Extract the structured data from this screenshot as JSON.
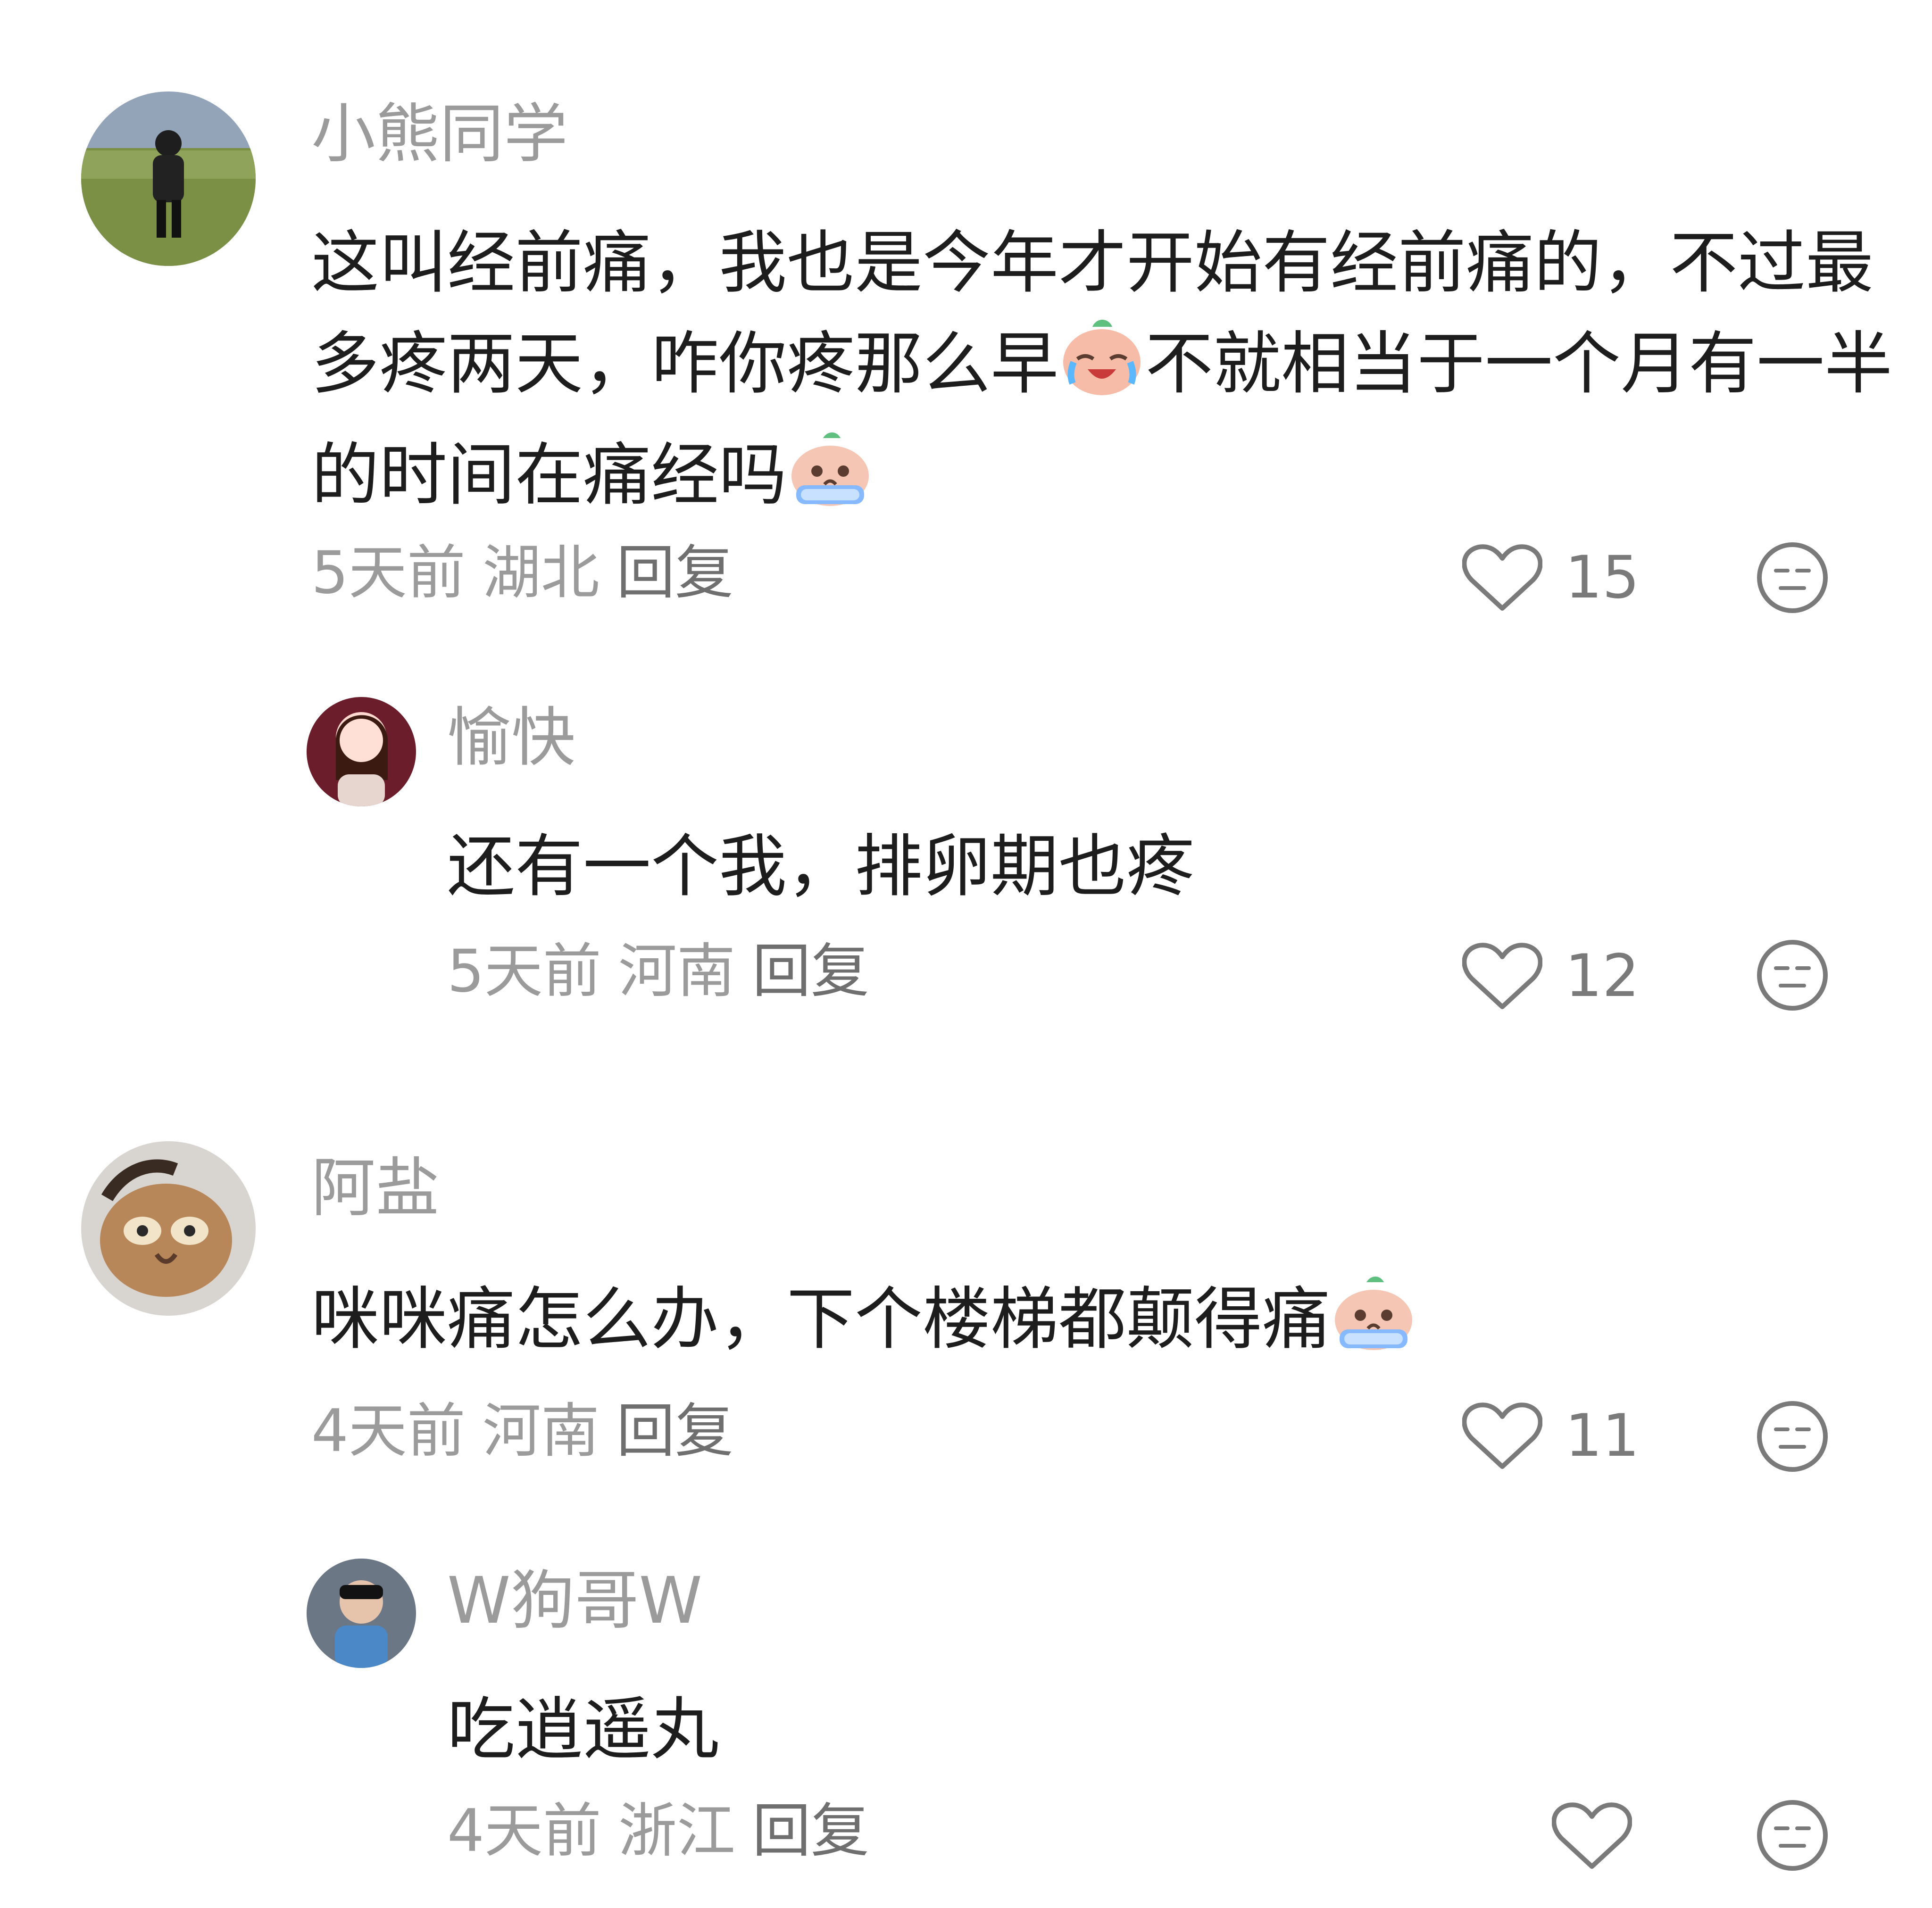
{
  "comments": [
    {
      "username": "小熊同学",
      "text_a": "这叫经前痛，我也是今年才开始有经前痛的，不过最多疼两天，咋你疼那么早",
      "text_b": "不就相当于一个月有一半的时间在痛经吗",
      "emoji_a": "laugh-cry-icon",
      "emoji_b": "crying-icon",
      "time": "5天前",
      "location": "湖北",
      "reply_label": "回复",
      "likes": "15"
    },
    {
      "username": "愉快",
      "text": "还有一个我，排卵期也疼",
      "time": "5天前",
      "location": "河南",
      "reply_label": "回复",
      "likes": "12"
    },
    {
      "username": "阿盐",
      "text": "咪咪痛怎么办，下个楼梯都颠得痛",
      "emoji": "crying-icon",
      "time": "4天前",
      "location": "河南",
      "reply_label": "回复",
      "likes": "11"
    },
    {
      "username": "W狗哥W",
      "text": "吃逍遥丸",
      "time": "4天前",
      "location": "浙江",
      "reply_label": "回复",
      "likes": ""
    }
  ],
  "colors": {
    "text": "#1d1d1d",
    "muted": "#9b9b9b",
    "icon": "#7a7a7a"
  }
}
